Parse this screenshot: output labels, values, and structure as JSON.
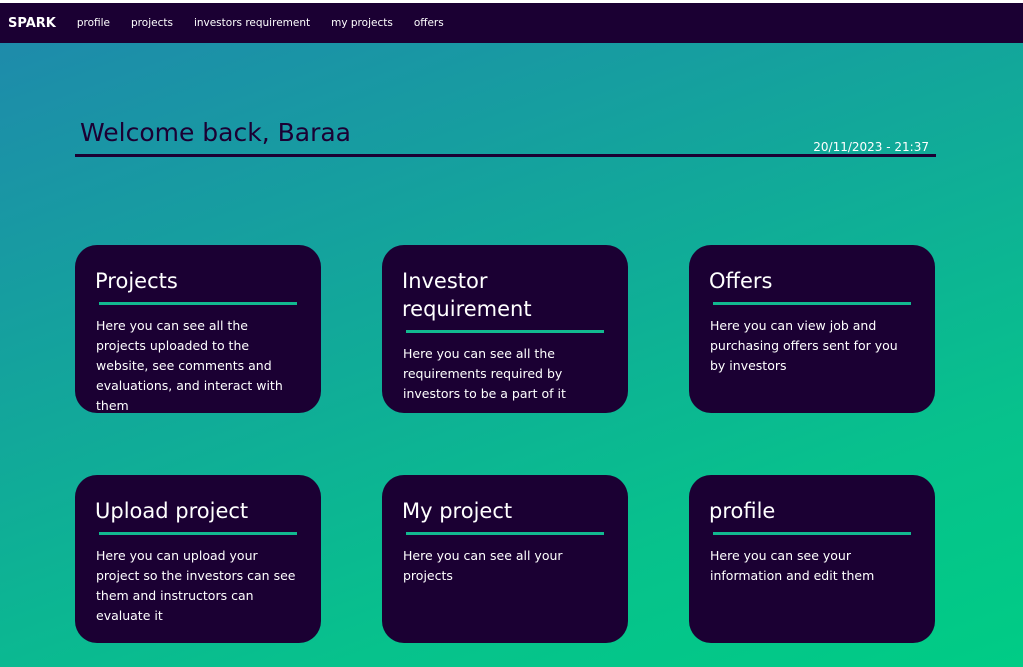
{
  "navbar": {
    "brand": "SPARK",
    "links": [
      "profile",
      "projects",
      "investors requirement",
      "my projects",
      "offers"
    ]
  },
  "header": {
    "welcome": "Welcome back, Baraa",
    "datetime": "20/11/2023 - 21:37"
  },
  "cards": [
    {
      "title": "Projects",
      "description": "Here you can see all the projects uploaded to the website, see comments and evaluations, and interact with them"
    },
    {
      "title": "Investor requirement",
      "description": "Here you can see all the requirements required by investors to be a part of it"
    },
    {
      "title": "Offers",
      "description": "Here you can view job and purchasing offers sent for you by investors"
    },
    {
      "title": "Upload project",
      "description": "Here you can upload your project so the investors can see them and instructors can evaluate it"
    },
    {
      "title": "My project",
      "description": "Here you can see all your projects"
    },
    {
      "title": "profile",
      "description": "Here you can see your information and edit them"
    }
  ],
  "colors": {
    "navbar": "#1b0033",
    "card": "#1b0033",
    "accent": "#12b990",
    "gradient_start": "#1e8bab",
    "gradient_end": "#00cc85"
  }
}
